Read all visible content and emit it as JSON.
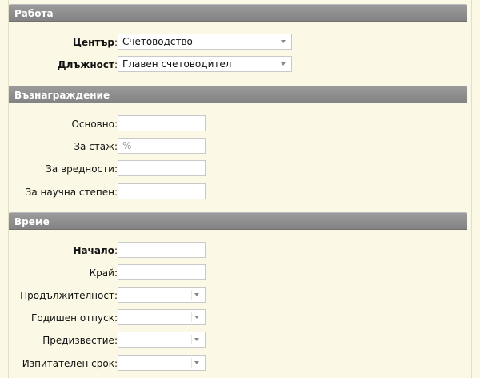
{
  "sections": {
    "work": {
      "title": "Работа",
      "center_label": "Център",
      "center_value": "Счетоводство",
      "position_label": "Длъжност",
      "position_value": "Главен счетоводител"
    },
    "pay": {
      "title": "Възнаграждение",
      "basic_label": "Основно:",
      "seniority_label": "За стаж:",
      "seniority_placeholder": "%",
      "hazard_label": "За вредности:",
      "degree_label": "За научна степен:"
    },
    "time": {
      "title": "Време",
      "start_label": "Начало",
      "end_label": "Край:",
      "duration_label": "Продължителност:",
      "leave_label": "Годишен отпуск:",
      "notice_label": "Предизвестие:",
      "probation_label": "Изпитателен срок:"
    }
  },
  "colors": {
    "background": "#fbf9e6",
    "header": "#8f8f8f",
    "header_text": "#ffffff"
  }
}
